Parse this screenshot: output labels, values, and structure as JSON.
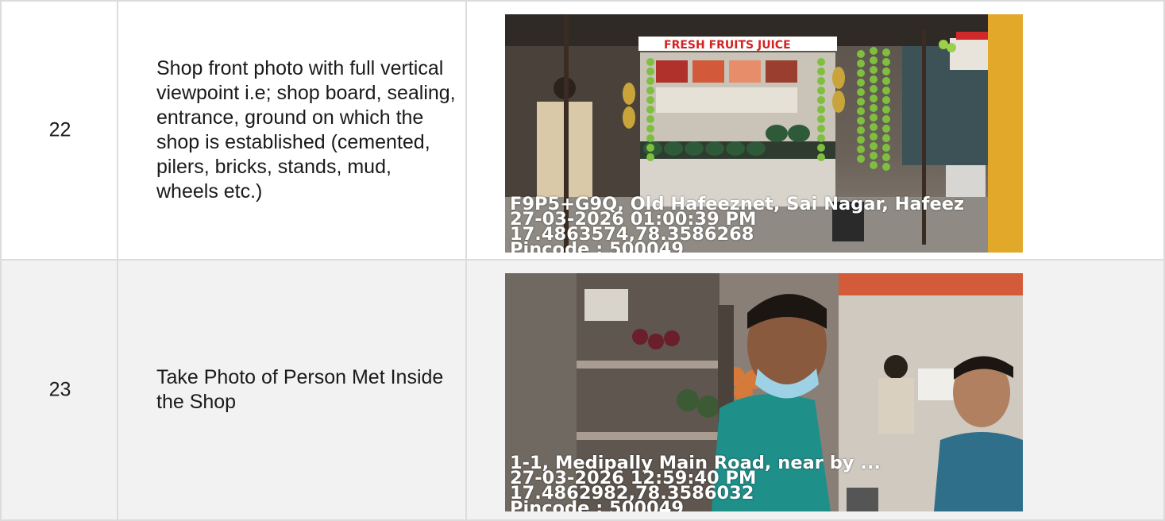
{
  "rows": [
    {
      "number": "22",
      "description": "Shop front photo with full vertical viewpoint i.e; shop board, sealing, entrance, ground on which the shop is established (cemented, pilers, bricks, stands, mud, wheels etc.)",
      "photo": {
        "sign_text": "FRESH FRUITS JUICE",
        "stamp": {
          "address": "F9P5+G9Q, Old Hafeeznet, Sai Nagar, Hafeez",
          "datetime": "27-03-2026 01:00:39 PM",
          "coordinates": "17.4863574,78.3586268",
          "pincode": "Pincode : 500049"
        }
      }
    },
    {
      "number": "23",
      "description": "Take Photo of Person Met Inside the Shop",
      "photo": {
        "stamp": {
          "address": "1-1, Medipally Main Road, near by ...",
          "datetime": "27-03-2026 12:59:40 PM",
          "coordinates": "17.4862982,78.3586032",
          "pincode": "Pincode : 500049"
        }
      }
    }
  ],
  "colors": {
    "border": "#dcdcdc",
    "alt_row": "#f2f2f2",
    "stamp_text": "#ffffff"
  }
}
